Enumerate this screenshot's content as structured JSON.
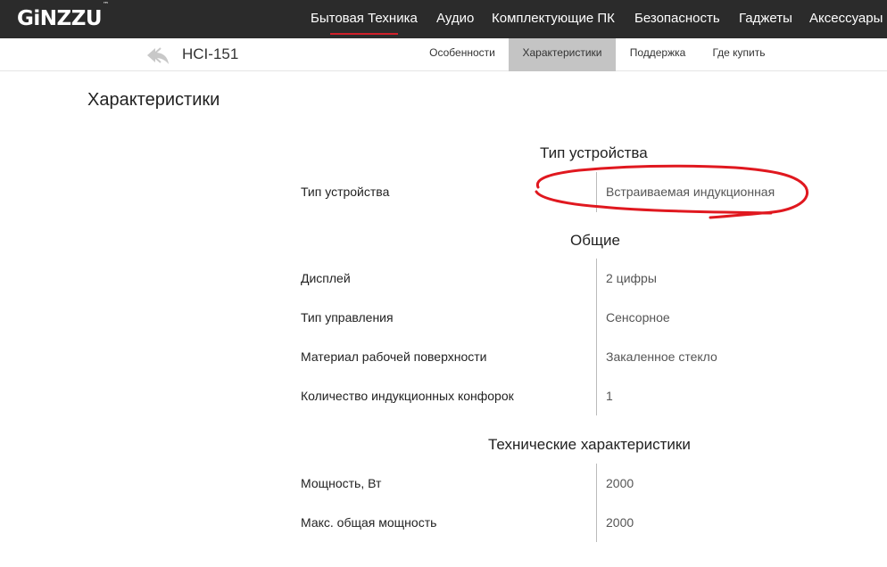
{
  "header": {
    "logo": "GiNZZU",
    "logo_tm": "™",
    "nav": [
      "Бытовая Техника",
      "Аудио",
      "Комплектующие ПК",
      "Безопасность",
      "Гаджеты",
      "Аксессуары"
    ],
    "active_nav_index": 0,
    "accent_color": "#d0202a"
  },
  "subheader": {
    "back_icon": "back-arrow-icon",
    "model": "HCI-151",
    "tabs": [
      "Особенности",
      "Характеристики",
      "Поддержка",
      "Где купить"
    ],
    "active_tab_index": 1
  },
  "page": {
    "title": "Характеристики"
  },
  "specs": {
    "sections": [
      {
        "title": "Тип устройства",
        "rows": [
          {
            "label": "Тип устройства",
            "value": "Встраиваемая индукционная"
          }
        ]
      },
      {
        "title": "Общие",
        "rows": [
          {
            "label": "Дисплей",
            "value": "2 цифры"
          },
          {
            "label": "Тип управления",
            "value": "Сенсорное"
          },
          {
            "label": "Материал рабочей поверхности",
            "value": "Закаленное стекло"
          },
          {
            "label": "Количество индукционных конфорок",
            "value": "1"
          }
        ]
      },
      {
        "title": "Технические характеристики",
        "rows": [
          {
            "label": "Мощность, Вт",
            "value": "2000"
          },
          {
            "label": "Макс. общая мощность",
            "value": "2000"
          }
        ]
      }
    ]
  },
  "annotation": {
    "color": "#e0181f"
  }
}
